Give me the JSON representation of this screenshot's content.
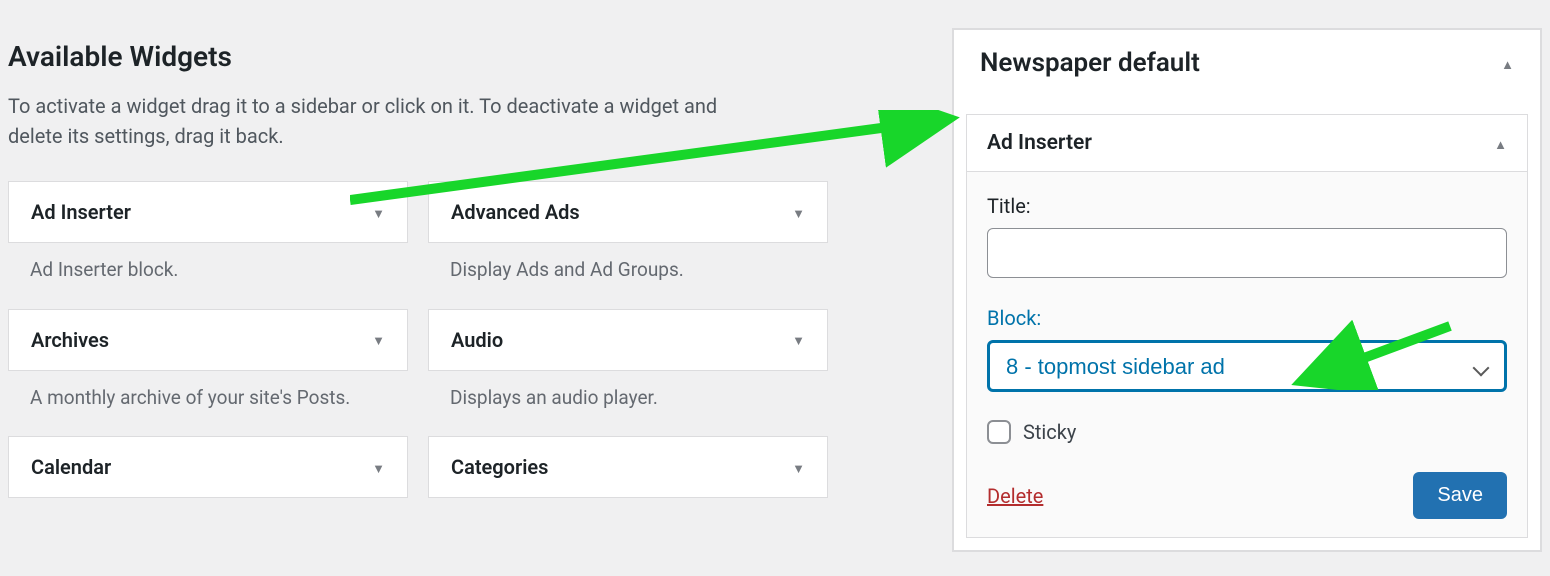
{
  "heading": "Available Widgets",
  "description": "To activate a widget drag it to a sidebar or click on it. To deactivate a widget and delete its settings, drag it back.",
  "widgets": [
    {
      "title": "Ad Inserter",
      "desc": "Ad Inserter block."
    },
    {
      "title": "Advanced Ads",
      "desc": "Display Ads and Ad Groups."
    },
    {
      "title": "Archives",
      "desc": "A monthly archive of your site's Posts."
    },
    {
      "title": "Audio",
      "desc": "Displays an audio player."
    },
    {
      "title": "Calendar",
      "desc": ""
    },
    {
      "title": "Categories",
      "desc": ""
    }
  ],
  "sidebar": {
    "title": "Newspaper default",
    "widget": {
      "title": "Ad Inserter",
      "form": {
        "title_label": "Title:",
        "title_value": "",
        "block_label": "Block:",
        "block_value": "8 - topmost sidebar ad",
        "sticky_label": "Sticky",
        "delete_label": "Delete",
        "save_label": "Save"
      }
    }
  }
}
